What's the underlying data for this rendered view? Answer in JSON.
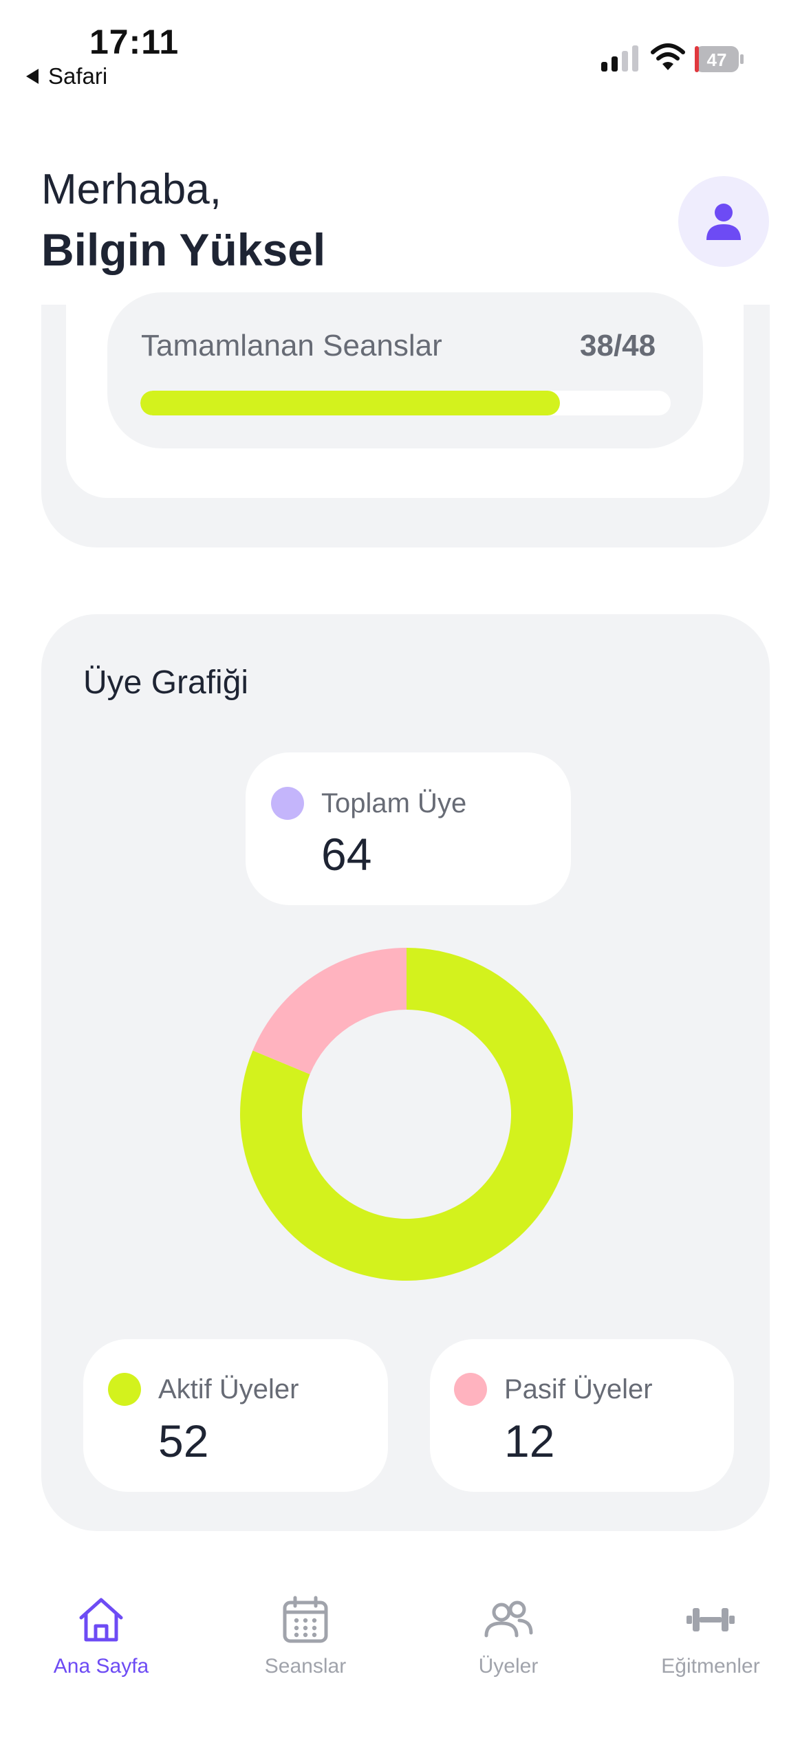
{
  "status_bar": {
    "time": "17:11",
    "back_label": "Safari",
    "battery": "47"
  },
  "greeting": {
    "hello": "Merhaba,",
    "name": "Bilgin Yüksel"
  },
  "sessions": {
    "label": "Tamamlanan Seanslar",
    "count": "38/48",
    "completed": 38,
    "total": 48
  },
  "member_chart": {
    "title": "Üye Grafiği",
    "total": {
      "label": "Toplam Üye",
      "value": "64"
    },
    "active": {
      "label": "Aktif Üyeler",
      "value": "52"
    },
    "passive": {
      "label": "Pasif Üyeler",
      "value": "12"
    }
  },
  "chart_data": {
    "type": "pie",
    "categories": [
      "Aktif Üyeler",
      "Pasif Üyeler"
    ],
    "values": [
      52,
      12
    ],
    "colors": [
      "#d3f21d",
      "#ffb3bf"
    ]
  },
  "colors": {
    "accent": "#6d4bf4",
    "lime": "#d3f21d",
    "pink": "#ffb3bf",
    "lavender": "#c4b5fb",
    "muted": "#a0a3ab"
  },
  "tabbar": {
    "home": {
      "label": "Ana Sayfa",
      "icon": "home-icon"
    },
    "sessions": {
      "label": "Seanslar",
      "icon": "calendar-icon"
    },
    "members": {
      "label": "Üyeler",
      "icon": "users-icon"
    },
    "trainers": {
      "label": "Eğitmenler",
      "icon": "dumbbell-icon"
    }
  }
}
